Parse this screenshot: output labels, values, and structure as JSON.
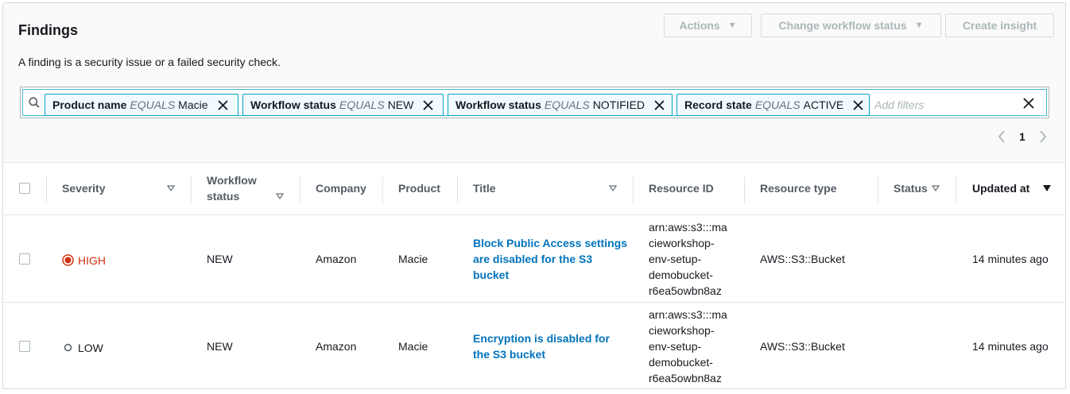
{
  "header": {
    "title": "Findings",
    "description": "A finding is a security issue or a failed security check.",
    "actions_label": "Actions",
    "change_workflow_label": "Change workflow status",
    "create_insight_label": "Create insight"
  },
  "filters": {
    "tokens": [
      {
        "field": "Product name",
        "op": "EQUALS",
        "value": "Macie"
      },
      {
        "field": "Workflow status",
        "op": "EQUALS",
        "value": "NEW"
      },
      {
        "field": "Workflow status",
        "op": "EQUALS",
        "value": "NOTIFIED"
      },
      {
        "field": "Record state",
        "op": "EQUALS",
        "value": "ACTIVE"
      }
    ],
    "placeholder": "Add filters"
  },
  "pagination": {
    "current_page": "1"
  },
  "table": {
    "columns": {
      "severity": "Severity",
      "workflow_status_1": "Workflow",
      "workflow_status_2": "status",
      "company": "Company",
      "product": "Product",
      "title": "Title",
      "resource_id": "Resource ID",
      "resource_type": "Resource type",
      "status": "Status",
      "updated_at": "Updated at"
    },
    "rows": [
      {
        "severity": "HIGH",
        "workflow_status": "NEW",
        "company": "Amazon",
        "product": "Macie",
        "title_lines": [
          "Block Public Access settings",
          "are disabled for the S3",
          "bucket"
        ],
        "resource_id_lines": [
          "arn:aws:s3:::ma",
          "cieworkshop-",
          "env-setup-",
          "demobucket-",
          "r6ea5owbn8az"
        ],
        "resource_type": "AWS::S3::Bucket",
        "status": "",
        "updated_at": "14 minutes ago"
      },
      {
        "severity": "LOW",
        "workflow_status": "NEW",
        "company": "Amazon",
        "product": "Macie",
        "title_lines": [
          "Encryption is disabled for",
          "the S3 bucket"
        ],
        "resource_id_lines": [
          "arn:aws:s3:::ma",
          "cieworkshop-",
          "env-setup-",
          "demobucket-",
          "r6ea5owbn8az"
        ],
        "resource_type": "AWS::S3::Bucket",
        "status": "",
        "updated_at": "14 minutes ago"
      }
    ]
  },
  "colors": {
    "link": "#0073bb",
    "severity_high": "#d13212",
    "token_border": "#00a1c9",
    "disabled_text": "#aab7b8"
  },
  "icons": [
    "search-icon",
    "close-icon",
    "clear-filters-icon",
    "chevron-left-icon",
    "chevron-right-icon",
    "sort-icon",
    "sort-descending-icon",
    "severity-high-icon",
    "severity-low-icon"
  ]
}
